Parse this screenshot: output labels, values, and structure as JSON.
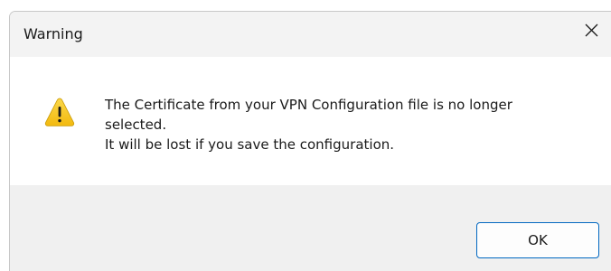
{
  "dialog": {
    "title": "Warning",
    "close_label": "Close",
    "icon": "warning-icon",
    "message_lines": [
      "The Certificate from your VPN Configuration file is no longer",
      "selected.",
      "It will be lost if you save the configuration."
    ],
    "ok_label": "OK"
  },
  "colors": {
    "titlebar_bg": "#f3f3f3",
    "footer_bg": "#f0f0f0",
    "ok_border": "#0067c0",
    "warning_fill": "#f7c928"
  }
}
